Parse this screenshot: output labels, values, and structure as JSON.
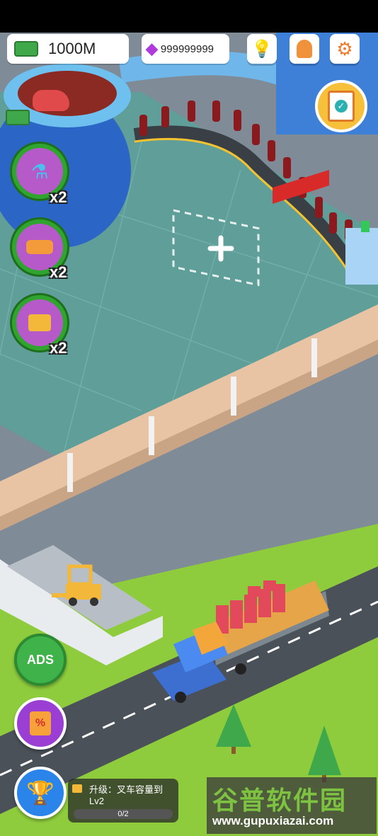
{
  "hud": {
    "cash": "1000M",
    "gems": "999999999"
  },
  "boosts": [
    {
      "multiplier": "x2",
      "icon": "conveyor-upgrade-icon"
    },
    {
      "multiplier": "x2",
      "icon": "truck-upgrade-icon"
    },
    {
      "multiplier": "x2",
      "icon": "forklift-upgrade-icon"
    }
  ],
  "buttons": {
    "ads": "ADS",
    "shop_badge": "%"
  },
  "quest": {
    "title": "升级：叉车容量到",
    "level": "Lv2",
    "progress_text": "0/2",
    "progress": 0
  },
  "watermark": {
    "brand": "谷普软件园",
    "url": "www.gupuxiazai.com"
  },
  "colors": {
    "floor": "#5f9e99",
    "road": "#7d8a96",
    "grass": "#8fcc3d",
    "boost_ring": "#2fa52f",
    "accent": "#f39a3a"
  }
}
